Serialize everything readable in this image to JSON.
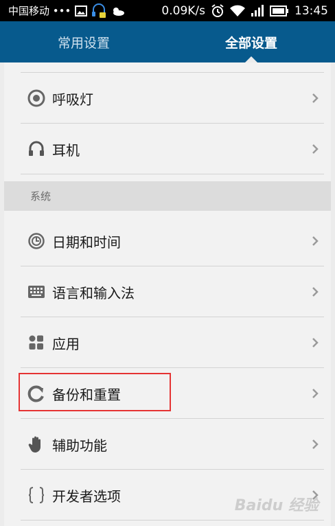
{
  "status_bar": {
    "carrier": "中国移动 •••",
    "network_speed": "0.09K/s",
    "time": "13:45",
    "icons": [
      "image-icon",
      "headset-icon",
      "weather-icon",
      "alarm-icon",
      "wifi-icon",
      "signal-icon",
      "battery-icon"
    ]
  },
  "tabs": [
    {
      "label": "常用设置",
      "active": false
    },
    {
      "label": "全部设置",
      "active": true
    }
  ],
  "items": {
    "breathing_light": "呼吸灯",
    "headset": "耳机",
    "section_system": "系统",
    "date_time": "日期和时间",
    "language_input": "语言和输入法",
    "apps": "应用",
    "backup_reset": "备份和重置",
    "accessibility": "辅助功能",
    "developer": "开发者选项"
  },
  "watermark": "Baidu 经验",
  "colors": {
    "header": "#075a8d",
    "highlight": "#e53333",
    "section_bg": "#dcdcdc"
  }
}
